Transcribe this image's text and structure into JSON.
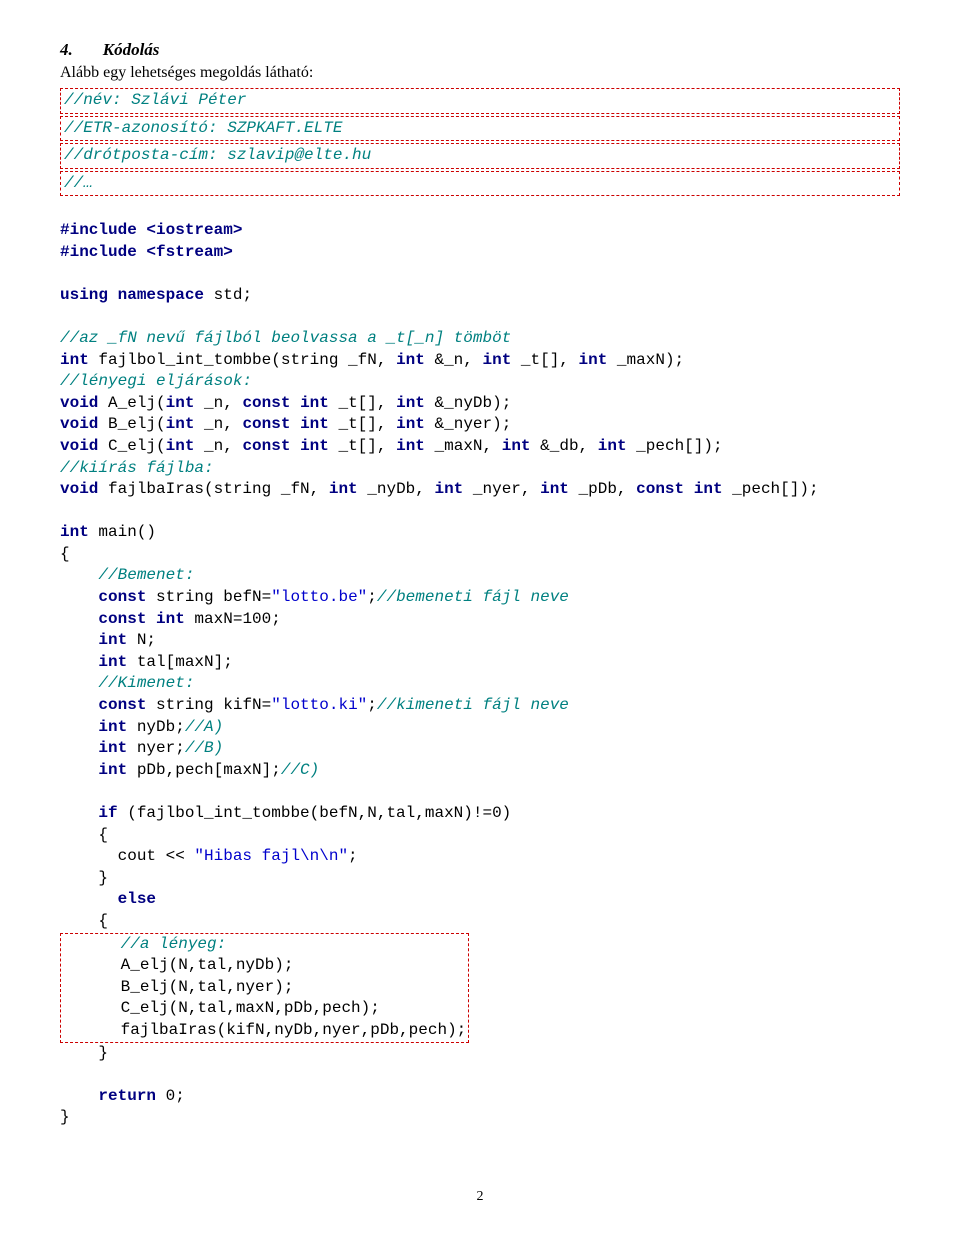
{
  "heading": {
    "num": "4.",
    "word": "Kódolás"
  },
  "intro": "Alább egy lehetséges megoldás látható:",
  "header_comments": [
    "//név: Szlávi Péter",
    "//ETR-azonosító: SZPKAFT.ELTE",
    "//drótposta-cím: szlavip@elte.hu",
    "//…"
  ],
  "c1": "#include <iostream>",
  "c2": "#include <fstream>",
  "c3a": "using namespace",
  "c3b": " std;",
  "cm1": "//az _fN nevű fájlból beolvassa a _t[_n] tömböt",
  "l1a": "int",
  "l1b": " fajlbol_int_tombbe(string _fN, ",
  "l1c": "int",
  "l1d": " &_n, ",
  "l1e": "int",
  "l1f": " _t[], ",
  "l1g": "int",
  "l1h": " _maxN);",
  "cm2": "//lényegi eljárások:",
  "l2a": "void",
  "l2b": " A_elj(",
  "l2c": "int",
  "l2d": " _n, ",
  "l2e": "const int",
  "l2f": " _t[], ",
  "l2g": "int",
  "l2h": " &_nyDb);",
  "l3a": "void",
  "l3b": " B_elj(",
  "l3c": "int",
  "l3d": " _n, ",
  "l3e": "const int",
  "l3f": " _t[], ",
  "l3g": "int",
  "l3h": " &_nyer);",
  "l4a": "void",
  "l4b": " C_elj(",
  "l4c": "int",
  "l4d": " _n, ",
  "l4e": "const int",
  "l4f": " _t[], ",
  "l4g": "int",
  "l4h": " _maxN, ",
  "l4i": "int",
  "l4j": " &_db, ",
  "l4k": "int",
  "l4l": " _pech[]);",
  "cm3": "//kiírás fájlba:",
  "l5a": "void",
  "l5b": " fajlbaIras(string _fN, ",
  "l5c": "int",
  "l5d": " _nyDb, ",
  "l5e": "int",
  "l5f": " _nyer, ",
  "l5g": "int",
  "l5h": " _pDb, ",
  "l5i": "const int",
  "l5j": " _pech[]);",
  "m1a": "int",
  "m1b": " main()",
  "m2": "{",
  "cmB": "    //Bemenet:",
  "m3a": "    const",
  "m3b": " string befN=",
  "m3c": "\"lotto.be\"",
  "m3d": ";",
  "m3e": "//bemeneti fájl neve",
  "m4a": "    const int",
  "m4b": " maxN=100;",
  "m5a": "    int",
  "m5b": " N;",
  "m6a": "    int",
  "m6b": " tal[maxN];",
  "cmK": "    //Kimenet:",
  "m7a": "    const",
  "m7b": " string kifN=",
  "m7c": "\"lotto.ki\"",
  "m7d": ";",
  "m7e": "//kimeneti fájl neve",
  "m8a": "    int",
  "m8b": " nyDb;",
  "m8c": "//A)",
  "m9a": "    int",
  "m9b": " nyer;",
  "m9c": "//B)",
  "m10a": "    int",
  "m10b": " pDb,pech[maxN];",
  "m10c": "//C)",
  "m11a": "    if",
  "m11b": " (fajlbol_int_tombbe(befN,N,tal,maxN)!=0)",
  "m12": "    {",
  "m13a": "      cout << ",
  "m13b": "\"Hibas fajl\\n\\n\"",
  "m13c": ";",
  "m14": "    }",
  "m15a": "      else",
  "m16": "    {",
  "cmL": "      //a lényeg:",
  "m17": "      A_elj(N,tal,nyDb);",
  "m18": "      B_elj(N,tal,nyer);",
  "m19": "      C_elj(N,tal,maxN,pDb,pech);",
  "m20": "      fajlbaIras(kifN,nyDb,nyer,pDb,pech);",
  "m21": "    }",
  "m22a": "    return",
  "m22b": " 0;",
  "m23": "}",
  "page": "2"
}
